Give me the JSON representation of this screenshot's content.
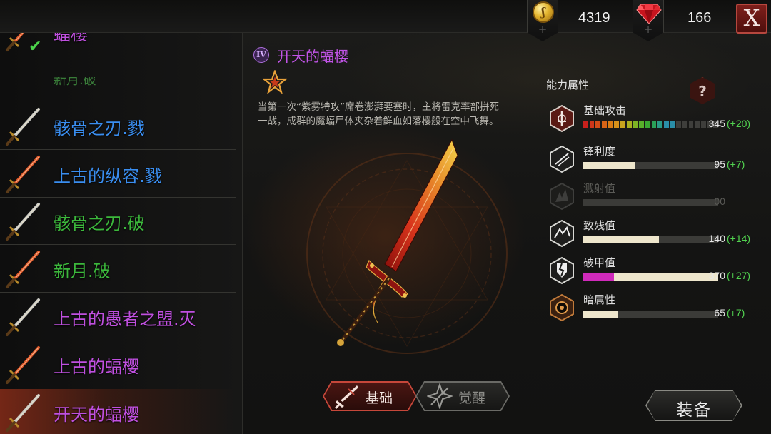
{
  "header": {
    "gold_count": "4319",
    "gem_count": "166",
    "close_label": "X"
  },
  "weapon_list": {
    "partial_label": "新月.破",
    "items": [
      {
        "name": "蝠樱",
        "color": "#c050e0",
        "equipped": true
      },
      {
        "name": "骸骨之刃.戮",
        "color": "#3a8ef0"
      },
      {
        "name": "上古的纵容.戮",
        "color": "#3a8ef0"
      },
      {
        "name": "骸骨之刃.破",
        "color": "#3cb83c"
      },
      {
        "name": "新月.破",
        "color": "#3cb83c"
      },
      {
        "name": "上古的愚者之盟.灭",
        "color": "#c050e0"
      },
      {
        "name": "上古的蝠樱",
        "color": "#c050e0"
      },
      {
        "name": "开天的蝠樱",
        "color": "#c050e0",
        "selected": true
      }
    ]
  },
  "detail": {
    "tier_badge": "IV",
    "weapon_name": "开天的蝠樱",
    "description": "当第一次“紫雾特攻”席卷澎湃要塞时，主将雷克率部拼死一战，成群的魔蝠尸体夹杂着鲜血如落樱般在空中飞舞。"
  },
  "stats": {
    "title": "能力属性",
    "help_label": "?",
    "items": [
      {
        "icon": "sword-crest-icon",
        "name": "基础攻击",
        "value": "345",
        "bonus": "(+20)",
        "fill": 0.69,
        "dim": false
      },
      {
        "icon": "slash-icon",
        "name": "锋利度",
        "value": "95",
        "bonus": "(+7)",
        "fill": 0.38,
        "dim": false
      },
      {
        "icon": "splash-icon",
        "name": "溅射值",
        "value": "00",
        "bonus": "",
        "fill": 0.0,
        "dim": true
      },
      {
        "icon": "crack-icon",
        "name": "致残值",
        "value": "140",
        "bonus": "(+14)",
        "fill": 0.56,
        "dim": false
      },
      {
        "icon": "armor-break-icon",
        "name": "破甲值",
        "value": "370",
        "bonus": "(+27)",
        "fill": 1.0,
        "pink": 0.23,
        "dim": false
      },
      {
        "icon": "dark-orb-icon",
        "name": "暗属性",
        "value": "65",
        "bonus": "(+7)",
        "fill": 0.26,
        "dim": false
      }
    ]
  },
  "tabs": {
    "basic_label": "基础",
    "awaken_label": "觉醒"
  },
  "actions": {
    "equip_label": "装备"
  }
}
